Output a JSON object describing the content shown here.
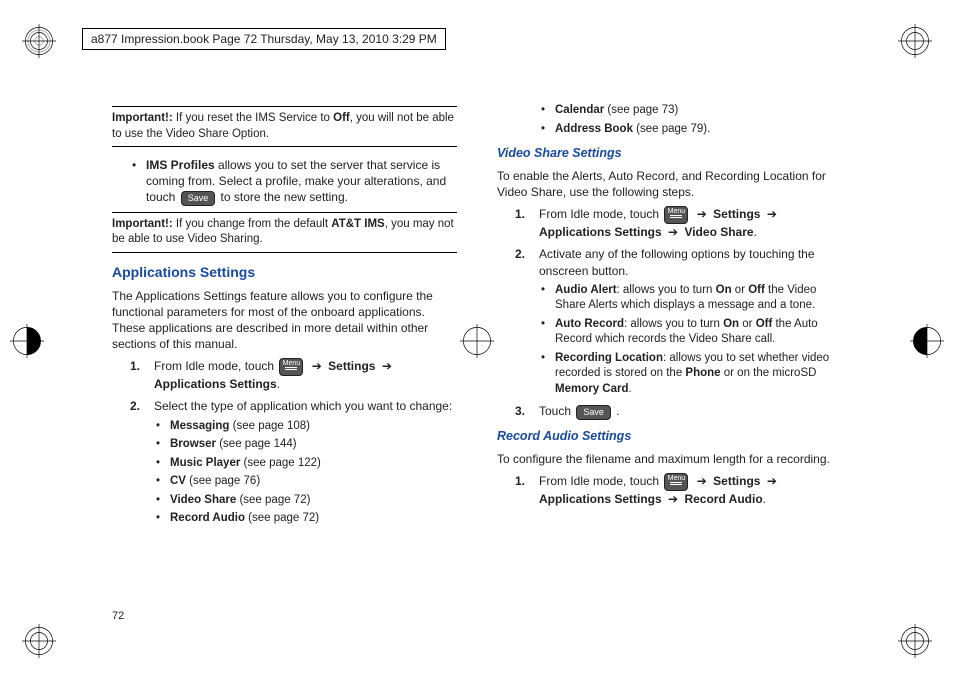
{
  "header": "a877 Impression.book  Page 72  Thursday, May 13, 2010  3:29 PM",
  "page_number": "72",
  "left": {
    "imp1_label": "Important!:",
    "imp1_text_a": "If you reset the IMS Service to ",
    "imp1_off": "Off",
    "imp1_text_b": ", you will not be able to use the Video Share Option.",
    "ims_profiles_b": "IMS Profiles",
    "ims_profiles_t1": " allows you to set the server that service is coming from. Select a profile, make your alterations, and touch ",
    "ims_profiles_t2": " to store the new setting.",
    "save_label": "Save",
    "imp2_label": "Important!:",
    "imp2_text_a": "If you change from the default ",
    "imp2_b": "AT&T IMS",
    "imp2_text_b": ", you may not be able to use Video Sharing.",
    "section": "Applications Settings",
    "para1": "The Applications Settings feature allows you to configure the functional parameters for most of the onboard applications. These applications are described in more detail within other sections of this manual.",
    "step1_a": "From Idle mode, touch ",
    "menu_label": "Menu",
    "step1_b": "Settings",
    "step1_c": "Applications Settings",
    "step2": "Select the type of application which you want to change:",
    "items": [
      {
        "b": "Messaging",
        "t": " (see page 108)"
      },
      {
        "b": "Browser",
        "t": " (see page 144)"
      },
      {
        "b": "Music Player",
        "t": " (see page 122)"
      },
      {
        "b": "CV",
        "t": " (see page 76)"
      },
      {
        "b": "Video Share",
        "t": " (see page 72)"
      },
      {
        "b": "Record Audio",
        "t": " (see page 72)"
      }
    ]
  },
  "right": {
    "top_items": [
      {
        "b": "Calendar",
        "t": " (see page 73)"
      },
      {
        "b": "Address Book",
        "t": " (see page 79)."
      }
    ],
    "vs_h": "Video Share Settings",
    "vs_para": "To enable the Alerts, Auto Record, and Recording Location for Video Share, use the following steps.",
    "vs_step1_a": "From Idle mode, touch ",
    "vs_step1_b": "Settings",
    "vs_step1_c": "Applications Settings",
    "vs_step1_d": "Video Share",
    "vs_step2": "Activate any of the following options by touching the onscreen button.",
    "vs_opts": [
      {
        "b": "Audio Alert",
        "t1": ": allows you to turn ",
        "on": "On",
        "or": " or ",
        "off": "Off",
        "t2": " the Video Share Alerts which displays a message and a tone."
      },
      {
        "b": "Auto Record",
        "t1": ": allows you to turn ",
        "on": "On",
        "or": " or ",
        "off": "Off",
        "t2": " the Auto Record which records the Video Share call."
      },
      {
        "b": "Recording Location",
        "t1": ": allows you to set whether video recorded is stored on the ",
        "on": "Phone",
        "or": " or on the microSD ",
        "off": "Memory Card",
        "t2": "."
      }
    ],
    "vs_step3_a": "Touch ",
    "vs_step3_save": "Save",
    "vs_step3_b": " .",
    "ra_h": "Record Audio Settings",
    "ra_para": "To configure the filename and maximum length for a recording.",
    "ra_step1_a": "From Idle mode, touch ",
    "ra_step1_b": "Settings",
    "ra_step1_c": "Applications Settings",
    "ra_step1_d": "Record Audio"
  },
  "arrow": "➔"
}
